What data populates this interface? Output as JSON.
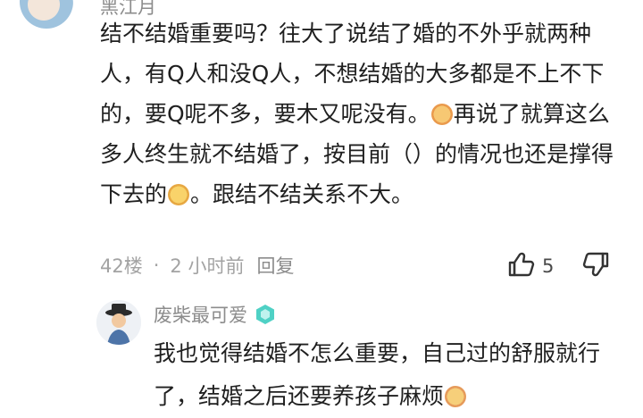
{
  "top_comment": {
    "username": "黑江月",
    "text_part1": "结不结婚重要吗？往大了说结了婚的不外乎就两种人，有Q人和没Q人，不想结婚的大多都是不上不下的，要Q呢不多，要木又呢没有。",
    "text_part2": "再说了就算这么多人终生就不结婚了，按目前（）的情况也还是撑得下去的",
    "text_part3": "。跟结不结关系不大。",
    "floor": "42楼",
    "separator": "·",
    "time": "2 小时前",
    "reply_label": "回复",
    "like_count": "5"
  },
  "reply": {
    "username": "废柴最可爱",
    "text": "我也觉得结婚不怎么重要，自己过的舒服就行了，结婚之后还要养孩子麻烦"
  },
  "colors": {
    "text": "#1f1f1f",
    "meta": "#a3a3a3",
    "username": "#8c8c8c",
    "badge": "#4fd1c5"
  }
}
